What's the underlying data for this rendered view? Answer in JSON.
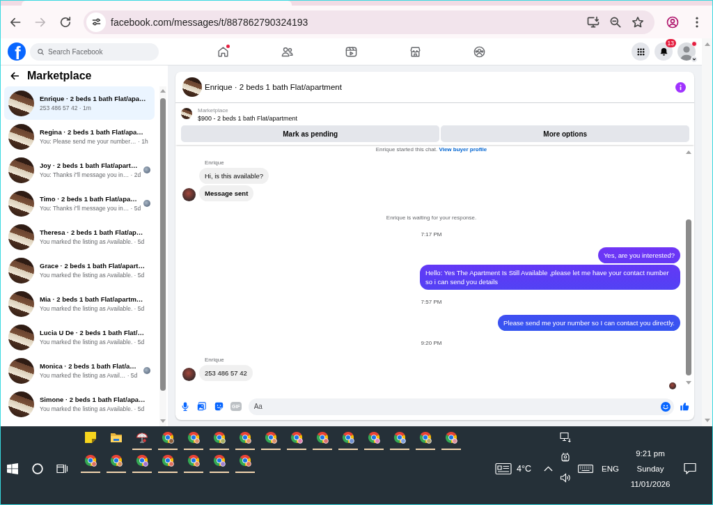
{
  "browser": {
    "url": "facebook.com/messages/t/887862790324193",
    "forward_disabled": true
  },
  "facebook_header": {
    "logo_text": "f",
    "search": {
      "placeholder": "Search Facebook"
    },
    "nav": [
      {
        "kind": "home",
        "dot": true
      },
      {
        "kind": "friends",
        "dot": false
      },
      {
        "kind": "video",
        "dot": false
      },
      {
        "kind": "marketplace",
        "dot": false
      },
      {
        "kind": "groups",
        "dot": false
      }
    ],
    "notifications_badge": "13",
    "profile_dot": true
  },
  "sidebar": {
    "title": "Marketplace",
    "conversations": [
      {
        "name": "Enrique · 2 beds 1 bath Flat/apa…",
        "preview": "253 486 57 42 · 1m",
        "selected": true,
        "seen": false
      },
      {
        "name": "Regina · 2 beds 1 bath Flat/apa…",
        "preview": "You: Please send me your number… · 1h",
        "selected": false,
        "seen": false
      },
      {
        "name": "Joy · 2 beds 1 bath Flat/apart…",
        "preview": "You: Thanks i\"ll message you in… · 2d",
        "selected": false,
        "seen": true
      },
      {
        "name": "Timo · 2 beds 1 bath Flat/apa…",
        "preview": "You: Thanks i\"ll message you in… · 5d",
        "selected": false,
        "seen": true
      },
      {
        "name": "Theresa · 2 beds 1 bath Flat/ap…",
        "preview": "You marked the listing as Available. · 5d",
        "selected": false,
        "seen": false
      },
      {
        "name": "Grace · 2 beds 1 bath Flat/apart…",
        "preview": "You marked the listing as Available. · 5d",
        "selected": false,
        "seen": false
      },
      {
        "name": "Mia · 2 beds 1 bath Flat/apartm…",
        "preview": "You marked the listing as Available. · 5d",
        "selected": false,
        "seen": false
      },
      {
        "name": "Lucia U De · 2 beds 1 bath Flat/…",
        "preview": "You marked the listing as Available. · 5d",
        "selected": false,
        "seen": false
      },
      {
        "name": "Monica · 2 beds 1 bath Flat/a…",
        "preview": "You marked the listing as Avail… · 5d",
        "selected": false,
        "seen": true
      },
      {
        "name": "Simone · 2 beds 1 bath Flat/apa…",
        "preview": "You marked the listing as Available. · 5d",
        "selected": false,
        "seen": false
      }
    ]
  },
  "chat": {
    "title": "Enrique · 2 beds 1 bath Flat/apartment",
    "listing": {
      "label": "Marketplace",
      "title": "$900 - 2 beds 1 bath Flat/apartment"
    },
    "actions": [
      "Mark as pending",
      "More options"
    ],
    "messages": [
      {
        "kind": "system",
        "text": "Enrique started this chat.",
        "link": "View buyer profile"
      },
      {
        "kind": "sender",
        "text": "Enrique"
      },
      {
        "kind": "in",
        "text": "Hi, is this available?",
        "avatar": false,
        "bold": false
      },
      {
        "kind": "in",
        "text": "Message sent",
        "avatar": true,
        "bold": true
      },
      {
        "kind": "notice",
        "text": "Enrique is waiting for your response."
      },
      {
        "kind": "time",
        "text": "7:17 PM"
      },
      {
        "kind": "out",
        "text": "Yes, are you interested?"
      },
      {
        "kind": "out",
        "text": "Hello: Yes The Apartment Is Still Available ,please let me have your contact number so i can send you details"
      },
      {
        "kind": "time",
        "text": "7:57 PM"
      },
      {
        "kind": "out",
        "text": "Please send me your number so I can contact you directly."
      },
      {
        "kind": "time",
        "text": "9:20 PM"
      },
      {
        "kind": "sender",
        "text": "Enrique"
      },
      {
        "kind": "in",
        "text": "253 486 57 42",
        "avatar": true,
        "bold": false
      },
      {
        "kind": "seen"
      }
    ],
    "composer": {
      "gif_label": "GIF",
      "placeholder": "Aa"
    }
  },
  "taskbar": {
    "pinned": [
      {
        "kind": "notes",
        "running": false
      },
      {
        "kind": "folder",
        "running": false
      },
      {
        "kind": "app",
        "running": true
      },
      {
        "kind": "browser",
        "running": true,
        "color": "#8b5e3c"
      },
      {
        "kind": "browser",
        "running": true,
        "color": "#e0906a"
      },
      {
        "kind": "browser",
        "running": true,
        "color": "#a8b060"
      },
      {
        "kind": "browser",
        "running": true,
        "color": "#e0906a"
      },
      {
        "kind": "browser",
        "running": true,
        "color": "#e0906a"
      },
      {
        "kind": "browser",
        "running": true,
        "color": "#e080b0"
      },
      {
        "kind": "browser",
        "running": true,
        "color": "#e07070"
      },
      {
        "kind": "browser",
        "running": true,
        "color": "#7090d0"
      },
      {
        "kind": "browser",
        "running": true,
        "color": "#e080c0"
      },
      {
        "kind": "browser",
        "running": true,
        "color": "#80a0e0"
      },
      {
        "kind": "browser",
        "running": true,
        "color": "#b0a070"
      },
      {
        "kind": "browser",
        "running": true,
        "color": "#e090a0"
      },
      {
        "kind": "browser",
        "running": true,
        "color": "#e07060"
      },
      {
        "kind": "browser",
        "running": true,
        "color": "#d89060"
      },
      {
        "kind": "browser",
        "running": true,
        "color": "#a070d0"
      },
      {
        "kind": "browser",
        "running": true,
        "color": "#e07060"
      },
      {
        "kind": "browser",
        "running": true,
        "color": "#e08060"
      },
      {
        "kind": "browser",
        "running": true,
        "color": "#a080d0"
      },
      {
        "kind": "browser",
        "running": true,
        "color": "#e07060"
      }
    ],
    "weather": "4°C",
    "language": "ENG",
    "time": "9:21 pm",
    "day": "Sunday",
    "date": "11/01/2026"
  }
}
